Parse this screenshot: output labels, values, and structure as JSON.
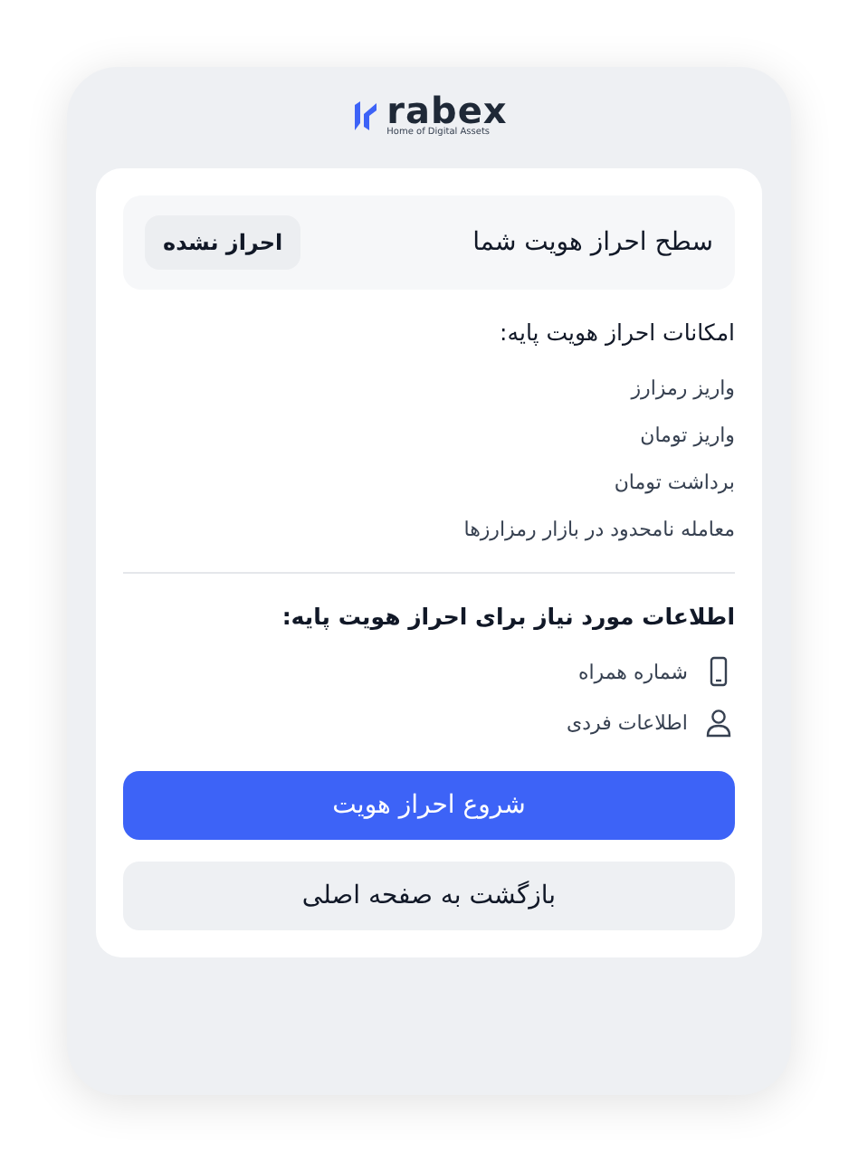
{
  "logo": {
    "name": "rabex",
    "tagline": "Home of Digital Assets"
  },
  "level": {
    "title": "سطح احراز هویت شما",
    "status": "احراز نشده"
  },
  "features": {
    "title": "امکانات احراز هویت پایه:",
    "items": [
      "واریز رمزارز",
      "واریز تومان",
      "برداشت تومان",
      "معامله نامحدود در بازار رمزارزها"
    ]
  },
  "requirements": {
    "title": "اطلاعات مورد نیاز برای احراز هویت پایه:",
    "items": [
      {
        "kind": "phone",
        "label": "شماره همراه"
      },
      {
        "kind": "person",
        "label": "اطلاعات فردی"
      }
    ]
  },
  "buttons": [
    {
      "kind": "primary",
      "label": "شروع احراز هویت"
    },
    {
      "kind": "secondary",
      "label": "بازگشت به صفحه اصلی"
    }
  ]
}
